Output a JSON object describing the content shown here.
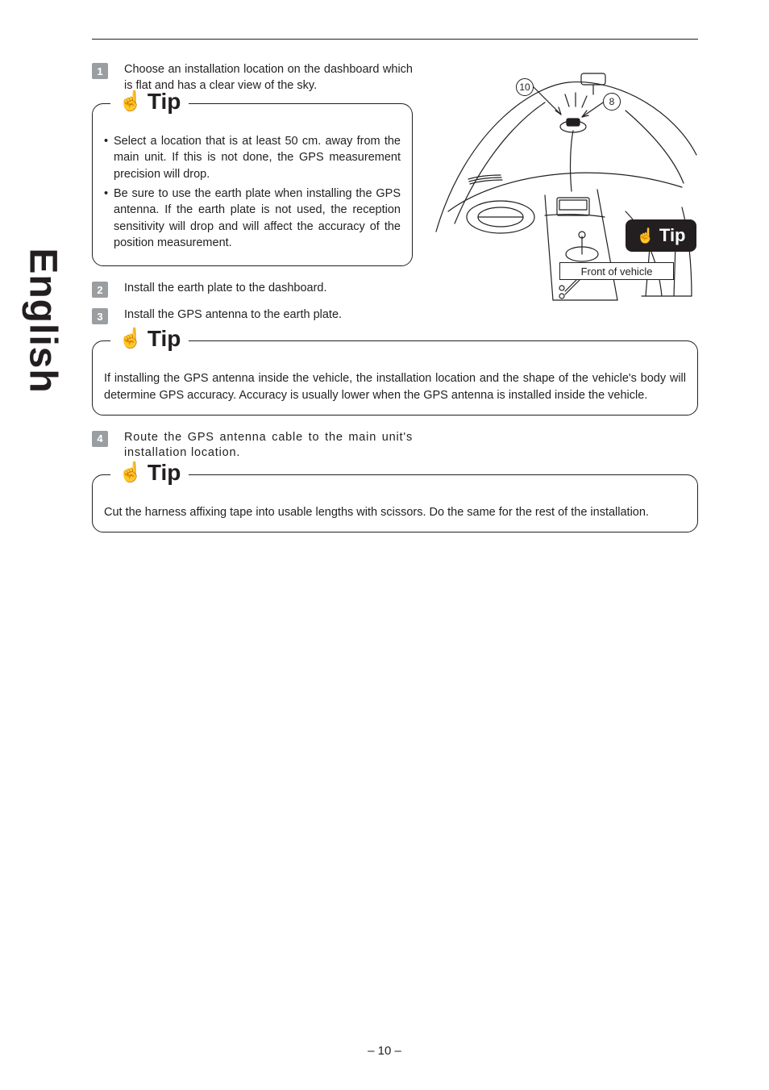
{
  "language_tab": "English",
  "steps": {
    "s1": {
      "num": "1",
      "text": "Choose an installation location on the dashboard which is flat and has a clear view of the sky."
    },
    "s2": {
      "num": "2",
      "text": "Install the earth plate to the dashboard."
    },
    "s3": {
      "num": "3",
      "text": "Install the GPS antenna to the earth plate."
    },
    "s4": {
      "num": "4",
      "text": "Route the GPS antenna cable to the main unit's installation location."
    }
  },
  "tips": {
    "label": "Tip",
    "tip1": {
      "items": [
        "Select a location that is at least 50 cm. away from the main unit. If this is not done, the GPS measurement precision will drop.",
        "Be sure to use the earth plate when installing the GPS antenna. If the earth plate is not used, the reception sensitivity will drop and will affect the accuracy of the position measurement."
      ]
    },
    "tip2": {
      "body": "If installing the GPS antenna inside the vehicle, the installation location and the shape of the vehicle's body will determine GPS accuracy.  Accuracy is usually lower when the GPS antenna is installed inside the vehicle."
    },
    "tip3": {
      "body": "Cut the harness affixing tape into usable lengths with scissors. Do the same for the rest of the installation."
    }
  },
  "diagram": {
    "callout_10": "10",
    "callout_8": "8",
    "front_label": "Front of vehicle",
    "tip_badge": "Tip"
  },
  "page_number": "– 10 –"
}
